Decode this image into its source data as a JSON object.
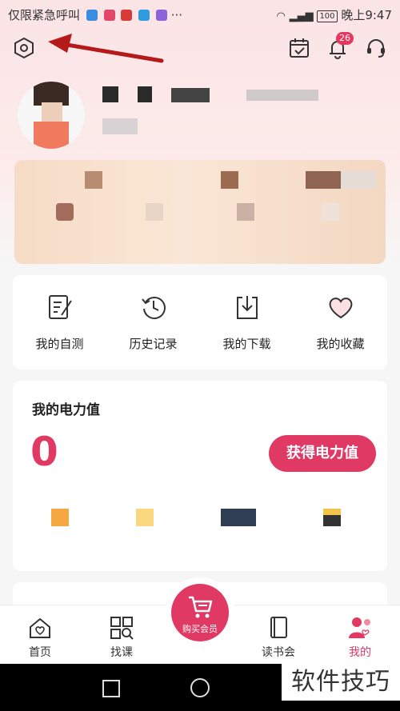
{
  "status_bar": {
    "carrier_text": "仅限紧急呼叫",
    "battery": "100",
    "time": "晚上9:47",
    "more": "···"
  },
  "header": {
    "settings_icon": "hexagon-settings-icon",
    "calendar_icon": "calendar-check-icon",
    "notification_icon": "bell-icon",
    "notification_count": "26",
    "support_icon": "headset-icon"
  },
  "quick_actions": [
    {
      "label": "我的自测",
      "icon": "self-test-icon"
    },
    {
      "label": "历史记录",
      "icon": "history-icon"
    },
    {
      "label": "我的下载",
      "icon": "download-icon"
    },
    {
      "label": "我的收藏",
      "icon": "heart-icon"
    }
  ],
  "power": {
    "title": "我的电力值",
    "value": "0",
    "button_label": "获得电力值"
  },
  "tabs": [
    {
      "label": "首页",
      "icon": "home-icon"
    },
    {
      "label": "找课",
      "icon": "find-course-icon"
    },
    {
      "label": "读书会",
      "icon": "book-icon"
    },
    {
      "label": "我的",
      "icon": "profile-icon"
    }
  ],
  "buy_button": {
    "label": "购买会员",
    "icon": "cart-icon"
  },
  "watermark": "软件技巧",
  "colors": {
    "accent": "#e03964",
    "background": "#f6f6f6",
    "hero": "#fbe4e6"
  }
}
